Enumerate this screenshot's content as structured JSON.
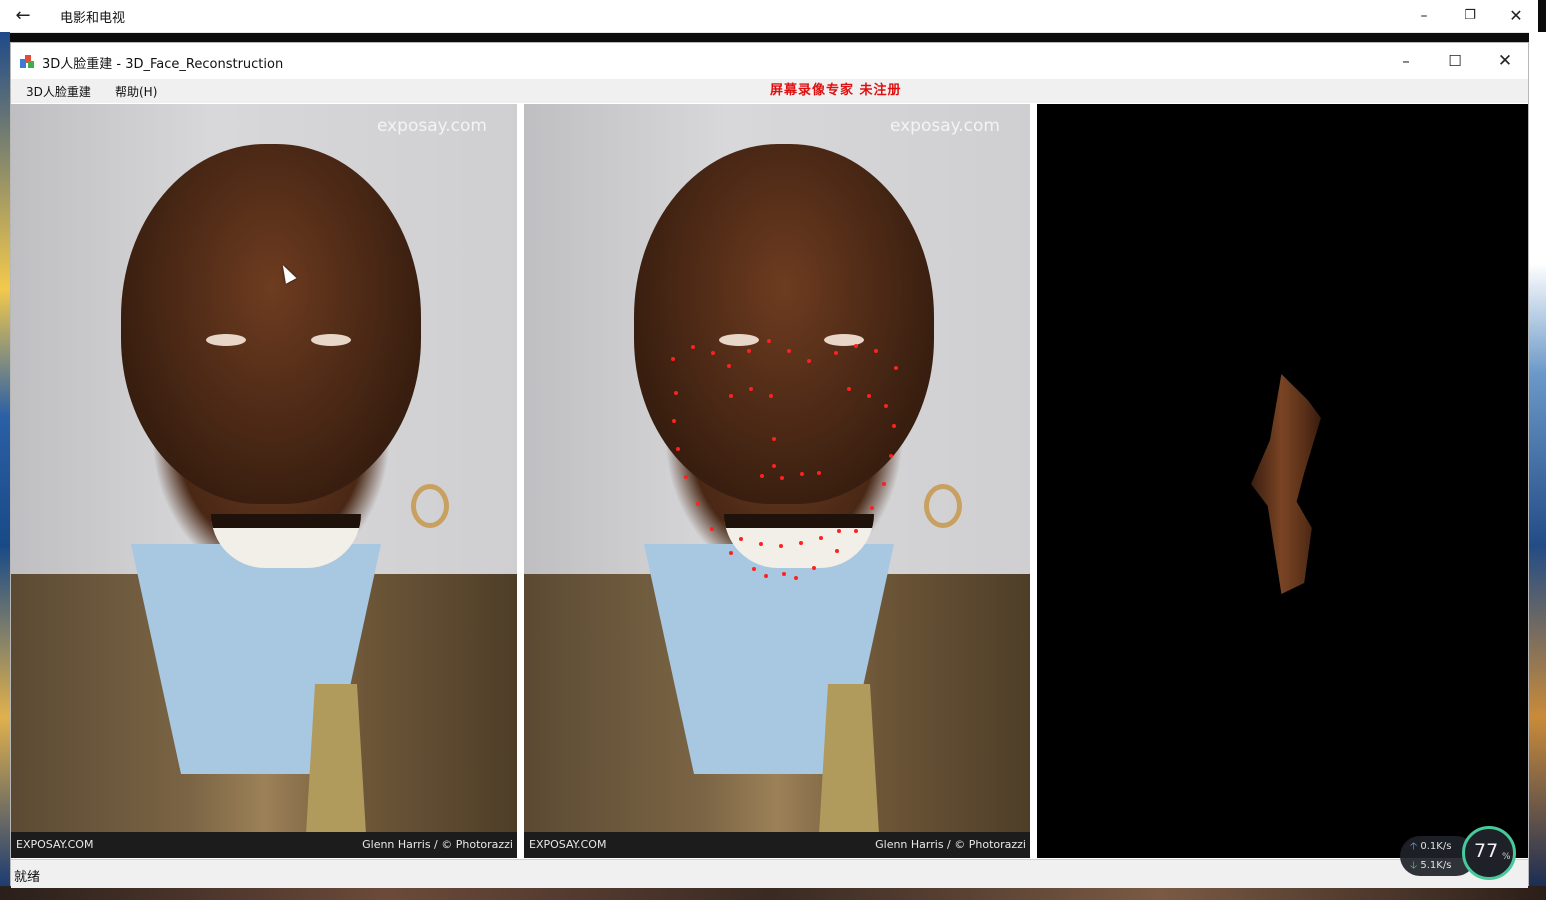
{
  "outer_window": {
    "title": "电影和电视",
    "back_icon": "back-arrow-icon",
    "controls": [
      "minimize-icon",
      "restore-icon",
      "close-icon"
    ]
  },
  "app_window": {
    "title": "3D人脸重建 - 3D_Face_Reconstruction",
    "icon": "app-icon",
    "controls": [
      "minimize-icon",
      "maximize-icon",
      "close-icon"
    ]
  },
  "menubar": {
    "items": [
      {
        "label": "3D人脸重建"
      },
      {
        "label": "帮助(H)"
      }
    ],
    "recorder_watermark": "屏幕录像专家  未注册"
  },
  "panels": {
    "original": {
      "site_watermark": "exposay.com",
      "caption_left": "EXPOSAY.COM",
      "caption_right": "Glenn Harris / © Photorazzi"
    },
    "landmarks": {
      "site_watermark": "exposay.com",
      "caption_left": "EXPOSAY.COM",
      "caption_right": "Glenn Harris / © Photorazzi",
      "point_color": "#ff2020"
    },
    "reconstruction": {
      "background": "#000000"
    }
  },
  "statusbar": {
    "text": "就绪"
  },
  "system_widget": {
    "upload": "0.1K/s",
    "download": "5.1K/s",
    "gauge_value": "77",
    "gauge_unit": "%"
  }
}
